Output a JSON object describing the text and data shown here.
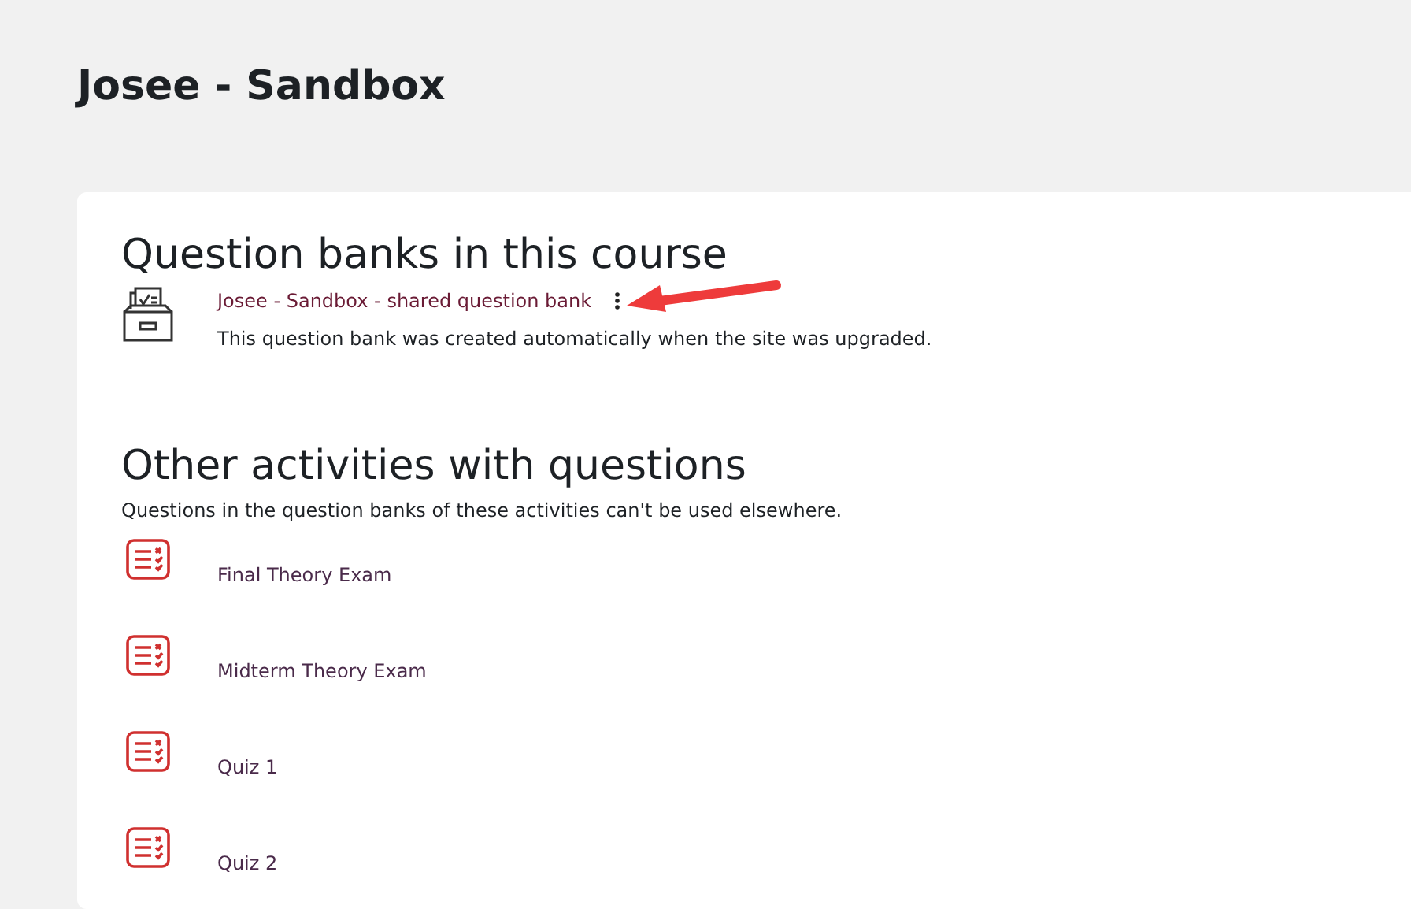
{
  "page_title": "Josee - Sandbox",
  "course_banks": {
    "heading": "Question banks in this course",
    "items": [
      {
        "name": "Josee - Sandbox - shared question bank",
        "description": "This question bank was created automatically when the site was upgraded."
      }
    ]
  },
  "other_activities": {
    "heading": "Other activities with questions",
    "description": "Questions in the question banks of these activities can't be used elsewhere.",
    "items": [
      {
        "name": "Final Theory Exam"
      },
      {
        "name": "Midterm Theory Exam"
      },
      {
        "name": "Quiz 1"
      },
      {
        "name": "Quiz 2"
      }
    ]
  }
}
